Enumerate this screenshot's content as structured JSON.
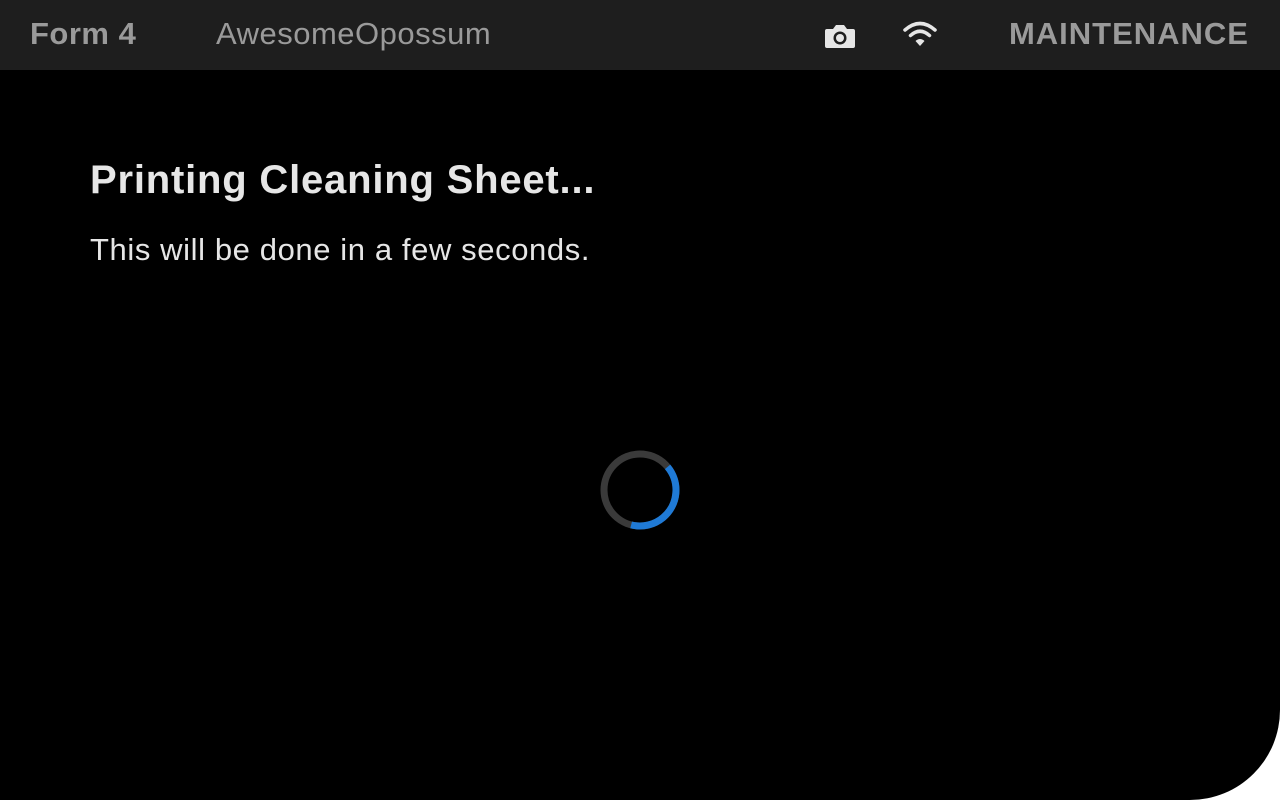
{
  "topbar": {
    "printer_model": "Form 4",
    "printer_name": "AwesomeOpossum",
    "camera_icon": "camera-icon",
    "wifi_icon": "wifi-icon",
    "status": "MAINTENANCE"
  },
  "main": {
    "title": "Printing Cleaning Sheet...",
    "subtitle": "This will be done in a few seconds.",
    "spinner_icon": "loading-spinner",
    "spinner_progress": 0.4
  },
  "colors": {
    "background": "#000000",
    "topbar": "#1e1e1e",
    "topbar_text": "#9a9a9a",
    "main_text": "#e6e6e6",
    "spinner_track": "#3a3a3a",
    "spinner_accent": "#1f7ad6"
  }
}
